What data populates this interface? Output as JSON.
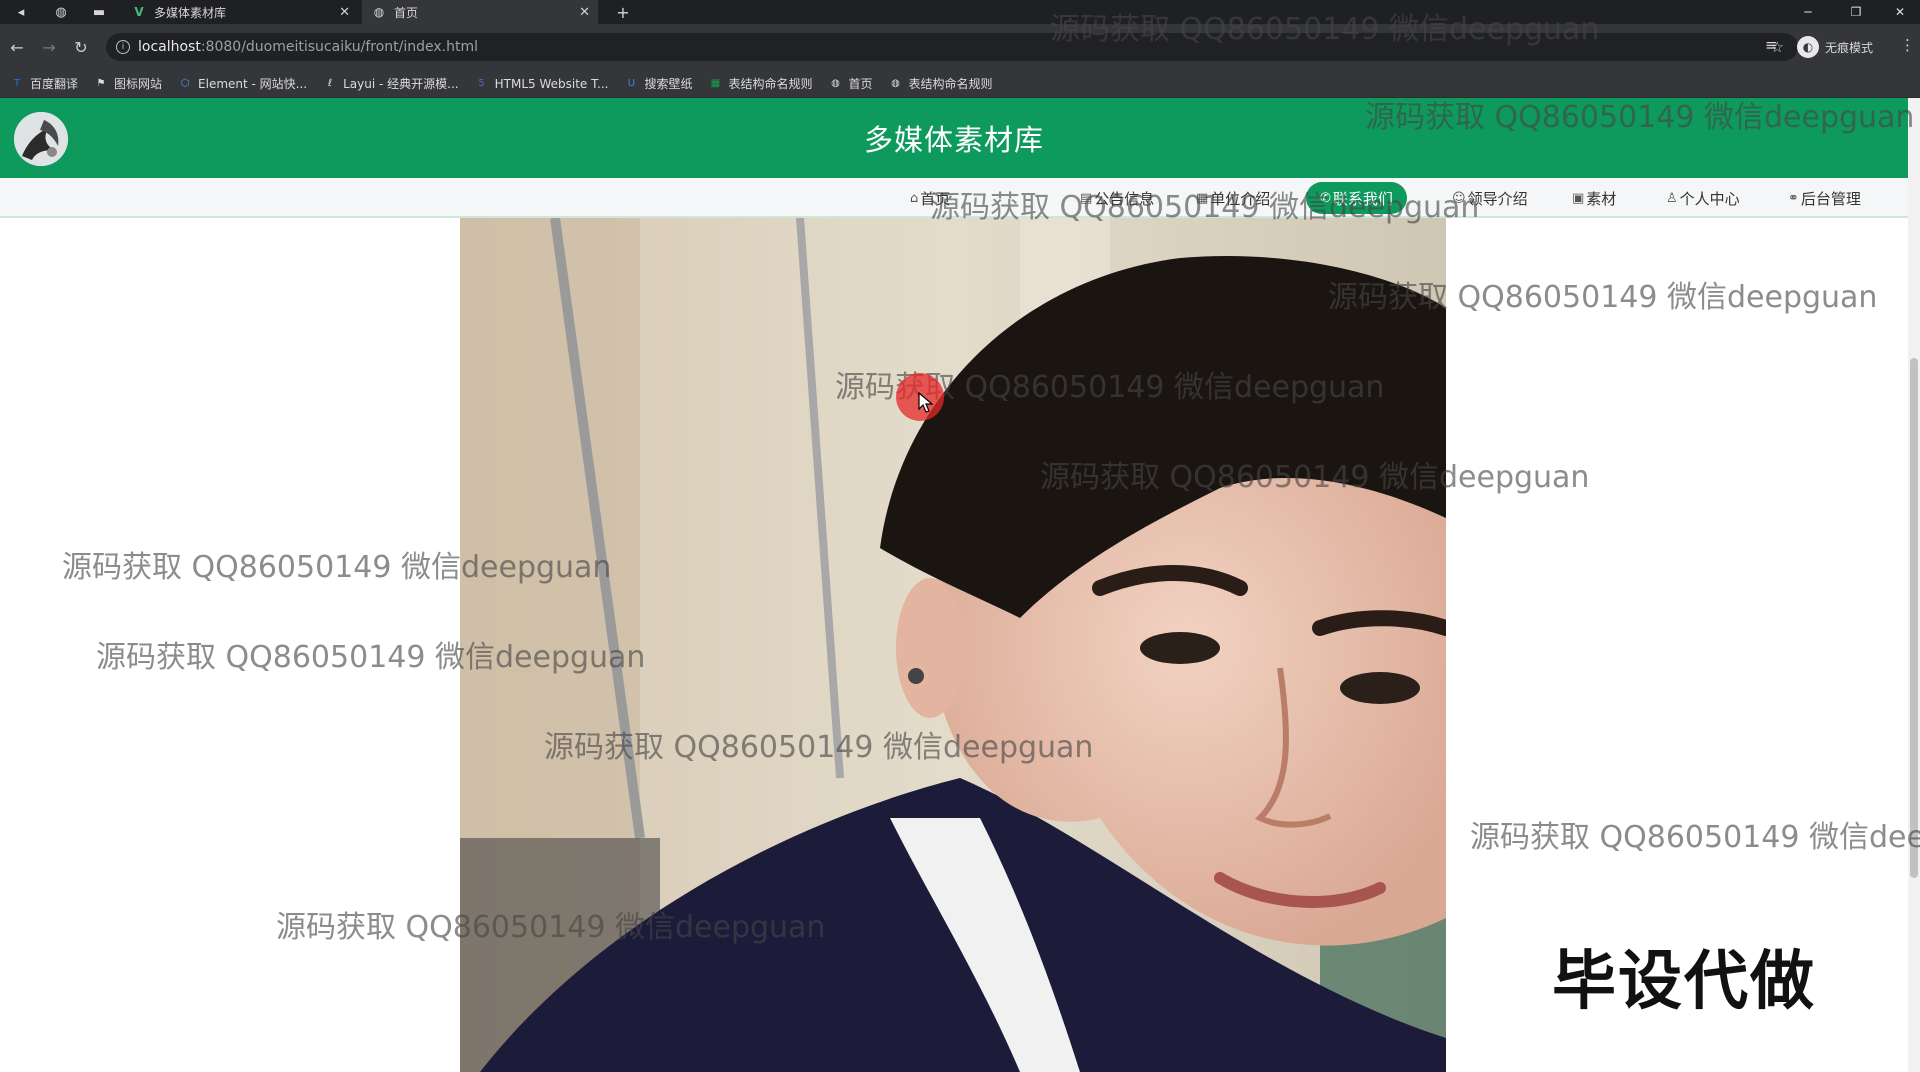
{
  "tabs": [
    {
      "title": "多媒体素材库",
      "active": false
    },
    {
      "title": "首页",
      "active": true
    }
  ],
  "address": {
    "host": "localhost",
    "path": ":8080/duomeitisucaiku/front/index.html"
  },
  "profile": {
    "label": "无痕模式"
  },
  "bookmarks": [
    {
      "label": "百度翻译",
      "icon": "translate-icon",
      "color": "#1f6feb"
    },
    {
      "label": "图标网站",
      "icon": "flag-icon",
      "color": "#dcdcdc"
    },
    {
      "label": "Element - 网站快...",
      "icon": "element-icon",
      "color": "#409eff"
    },
    {
      "label": "Layui - 经典开源模...",
      "icon": "layui-icon",
      "color": "#dcdcdc"
    },
    {
      "label": "HTML5 Website T...",
      "icon": "html5-icon",
      "color": "#6a5acd"
    },
    {
      "label": "搜索壁纸",
      "icon": "wallpaper-icon",
      "color": "#3b82f6"
    },
    {
      "label": "表结构命名规则",
      "icon": "sheet-icon",
      "color": "#16a34a"
    },
    {
      "label": "首页",
      "icon": "globe-icon",
      "color": "#dcdcdc"
    },
    {
      "label": "表结构命名规则",
      "icon": "globe-icon",
      "color": "#dcdcdc"
    }
  ],
  "site": {
    "title": "多媒体素材库",
    "nav": [
      {
        "label": "首页",
        "icon": "home-icon",
        "active": false
      },
      {
        "label": "公告信息",
        "icon": "notice-icon",
        "active": false
      },
      {
        "label": "单位介绍",
        "icon": "building-icon",
        "active": false
      },
      {
        "label": "联系我们",
        "icon": "phone-icon",
        "active": true
      },
      {
        "label": "领导介绍",
        "icon": "user-icon",
        "active": false
      },
      {
        "label": "素材",
        "icon": "image-icon",
        "active": false
      },
      {
        "label": "个人中心",
        "icon": "person-icon",
        "active": false
      },
      {
        "label": "后台管理",
        "icon": "link-icon",
        "active": false
      }
    ],
    "accent": "#0e9a5c"
  },
  "watermark_text": "源码获取 QQ86050149 微信deepguan",
  "badge_text": "毕设代做"
}
